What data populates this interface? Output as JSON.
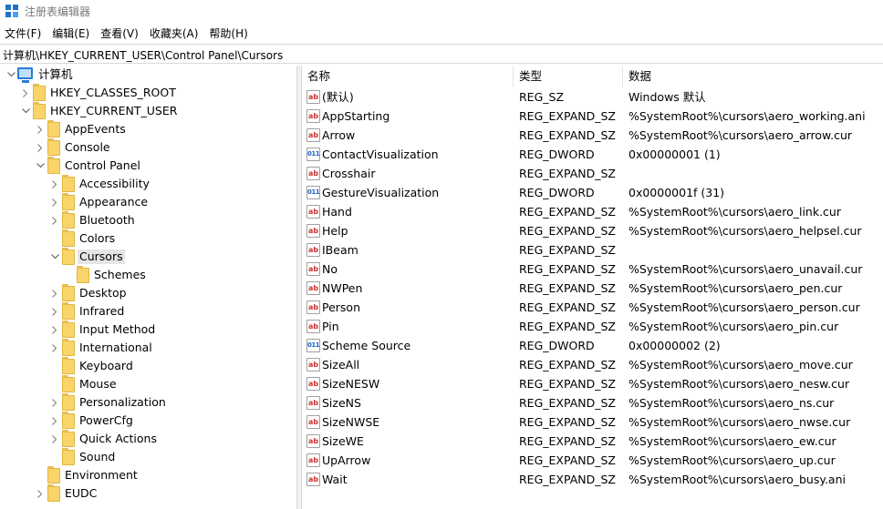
{
  "window": {
    "title": "注册表编辑器"
  },
  "menu": [
    "文件(F)",
    "编辑(E)",
    "查看(V)",
    "收藏夹(A)",
    "帮助(H)"
  ],
  "address": "计算机\\HKEY_CURRENT_USER\\Control Panel\\Cursors",
  "tree": [
    {
      "label": "计算机",
      "level": 0,
      "expand": "open",
      "type": "pc"
    },
    {
      "label": "HKEY_CLASSES_ROOT",
      "level": 1,
      "expand": "closed"
    },
    {
      "label": "HKEY_CURRENT_USER",
      "level": 1,
      "expand": "open"
    },
    {
      "label": "AppEvents",
      "level": 2,
      "expand": "closed"
    },
    {
      "label": "Console",
      "level": 2,
      "expand": "closed"
    },
    {
      "label": "Control Panel",
      "level": 2,
      "expand": "open"
    },
    {
      "label": "Accessibility",
      "level": 3,
      "expand": "closed"
    },
    {
      "label": "Appearance",
      "level": 3,
      "expand": "closed"
    },
    {
      "label": "Bluetooth",
      "level": 3,
      "expand": "closed"
    },
    {
      "label": "Colors",
      "level": 3,
      "expand": "none"
    },
    {
      "label": "Cursors",
      "level": 3,
      "expand": "open",
      "selected": true
    },
    {
      "label": "Schemes",
      "level": 4,
      "expand": "none"
    },
    {
      "label": "Desktop",
      "level": 3,
      "expand": "closed"
    },
    {
      "label": "Infrared",
      "level": 3,
      "expand": "closed"
    },
    {
      "label": "Input Method",
      "level": 3,
      "expand": "closed"
    },
    {
      "label": "International",
      "level": 3,
      "expand": "closed"
    },
    {
      "label": "Keyboard",
      "level": 3,
      "expand": "none"
    },
    {
      "label": "Mouse",
      "level": 3,
      "expand": "none"
    },
    {
      "label": "Personalization",
      "level": 3,
      "expand": "closed"
    },
    {
      "label": "PowerCfg",
      "level": 3,
      "expand": "closed"
    },
    {
      "label": "Quick Actions",
      "level": 3,
      "expand": "closed"
    },
    {
      "label": "Sound",
      "level": 3,
      "expand": "none"
    },
    {
      "label": "Environment",
      "level": 2,
      "expand": "none"
    },
    {
      "label": "EUDC",
      "level": 2,
      "expand": "closed"
    }
  ],
  "columns": {
    "name": "名称",
    "type": "类型",
    "data": "数据"
  },
  "values": [
    {
      "icon": "string-value-icon",
      "name": "(默认)",
      "type": "REG_SZ",
      "data": "Windows 默认"
    },
    {
      "icon": "string-value-icon",
      "name": "AppStarting",
      "type": "REG_EXPAND_SZ",
      "data": "%SystemRoot%\\cursors\\aero_working.ani"
    },
    {
      "icon": "string-value-icon",
      "name": "Arrow",
      "type": "REG_EXPAND_SZ",
      "data": "%SystemRoot%\\cursors\\aero_arrow.cur"
    },
    {
      "icon": "dword-value-icon",
      "name": "ContactVisualization",
      "type": "REG_DWORD",
      "data": "0x00000001 (1)"
    },
    {
      "icon": "string-value-icon",
      "name": "Crosshair",
      "type": "REG_EXPAND_SZ",
      "data": ""
    },
    {
      "icon": "dword-value-icon",
      "name": "GestureVisualization",
      "type": "REG_DWORD",
      "data": "0x0000001f (31)"
    },
    {
      "icon": "string-value-icon",
      "name": "Hand",
      "type": "REG_EXPAND_SZ",
      "data": "%SystemRoot%\\cursors\\aero_link.cur"
    },
    {
      "icon": "string-value-icon",
      "name": "Help",
      "type": "REG_EXPAND_SZ",
      "data": "%SystemRoot%\\cursors\\aero_helpsel.cur"
    },
    {
      "icon": "string-value-icon",
      "name": "IBeam",
      "type": "REG_EXPAND_SZ",
      "data": ""
    },
    {
      "icon": "string-value-icon",
      "name": "No",
      "type": "REG_EXPAND_SZ",
      "data": "%SystemRoot%\\cursors\\aero_unavail.cur"
    },
    {
      "icon": "string-value-icon",
      "name": "NWPen",
      "type": "REG_EXPAND_SZ",
      "data": "%SystemRoot%\\cursors\\aero_pen.cur"
    },
    {
      "icon": "string-value-icon",
      "name": "Person",
      "type": "REG_EXPAND_SZ",
      "data": "%SystemRoot%\\cursors\\aero_person.cur"
    },
    {
      "icon": "string-value-icon",
      "name": "Pin",
      "type": "REG_EXPAND_SZ",
      "data": "%SystemRoot%\\cursors\\aero_pin.cur"
    },
    {
      "icon": "dword-value-icon",
      "name": "Scheme Source",
      "type": "REG_DWORD",
      "data": "0x00000002 (2)"
    },
    {
      "icon": "string-value-icon",
      "name": "SizeAll",
      "type": "REG_EXPAND_SZ",
      "data": "%SystemRoot%\\cursors\\aero_move.cur"
    },
    {
      "icon": "string-value-icon",
      "name": "SizeNESW",
      "type": "REG_EXPAND_SZ",
      "data": "%SystemRoot%\\cursors\\aero_nesw.cur"
    },
    {
      "icon": "string-value-icon",
      "name": "SizeNS",
      "type": "REG_EXPAND_SZ",
      "data": "%SystemRoot%\\cursors\\aero_ns.cur"
    },
    {
      "icon": "string-value-icon",
      "name": "SizeNWSE",
      "type": "REG_EXPAND_SZ",
      "data": "%SystemRoot%\\cursors\\aero_nwse.cur"
    },
    {
      "icon": "string-value-icon",
      "name": "SizeWE",
      "type": "REG_EXPAND_SZ",
      "data": "%SystemRoot%\\cursors\\aero_ew.cur"
    },
    {
      "icon": "string-value-icon",
      "name": "UpArrow",
      "type": "REG_EXPAND_SZ",
      "data": "%SystemRoot%\\cursors\\aero_up.cur"
    },
    {
      "icon": "string-value-icon",
      "name": "Wait",
      "type": "REG_EXPAND_SZ",
      "data": "%SystemRoot%\\cursors\\aero_busy.ani"
    }
  ],
  "icons": {
    "app": "registry-editor-icon",
    "expand_open": "chevron-down-icon",
    "expand_closed": "chevron-right-icon",
    "folder": "folder-icon",
    "computer": "computer-icon"
  },
  "colors": {
    "folder": "#f9d46b",
    "selection": "#e5e5e5",
    "app_icon": "#1e73c8",
    "string_icon": "#d03030",
    "dword_icon": "#1e5fbf"
  }
}
